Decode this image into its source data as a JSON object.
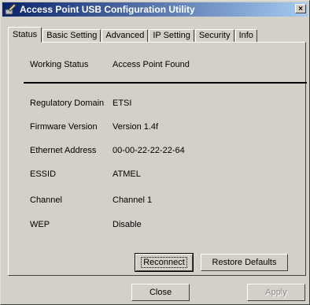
{
  "window": {
    "title": "Access Point USB Configuration Utility",
    "close_glyph": "×"
  },
  "tabs": [
    {
      "label": "Status"
    },
    {
      "label": "Basic Setting"
    },
    {
      "label": "Advanced"
    },
    {
      "label": "IP Setting"
    },
    {
      "label": "Security"
    },
    {
      "label": "Info"
    }
  ],
  "status": {
    "working_status_label": "Working Status",
    "working_status_value": "Access Point Found"
  },
  "details": {
    "regulatory_domain_label": "Regulatory Domain",
    "regulatory_domain_value": "ETSI",
    "firmware_version_label": "Firmware Version",
    "firmware_version_value": "Version  1.4f",
    "ethernet_address_label": "Ethernet Address",
    "ethernet_address_value": "00-00-22-22-22-64",
    "essid_label": "ESSID",
    "essid_value": "ATMEL",
    "channel_label": "Channel",
    "channel_value": "Channel  1",
    "wep_label": "WEP",
    "wep_value": "Disable"
  },
  "buttons": {
    "reconnect": "Reconnect",
    "restore_defaults": "Restore Defaults",
    "close": "Close",
    "apply": "Apply"
  }
}
